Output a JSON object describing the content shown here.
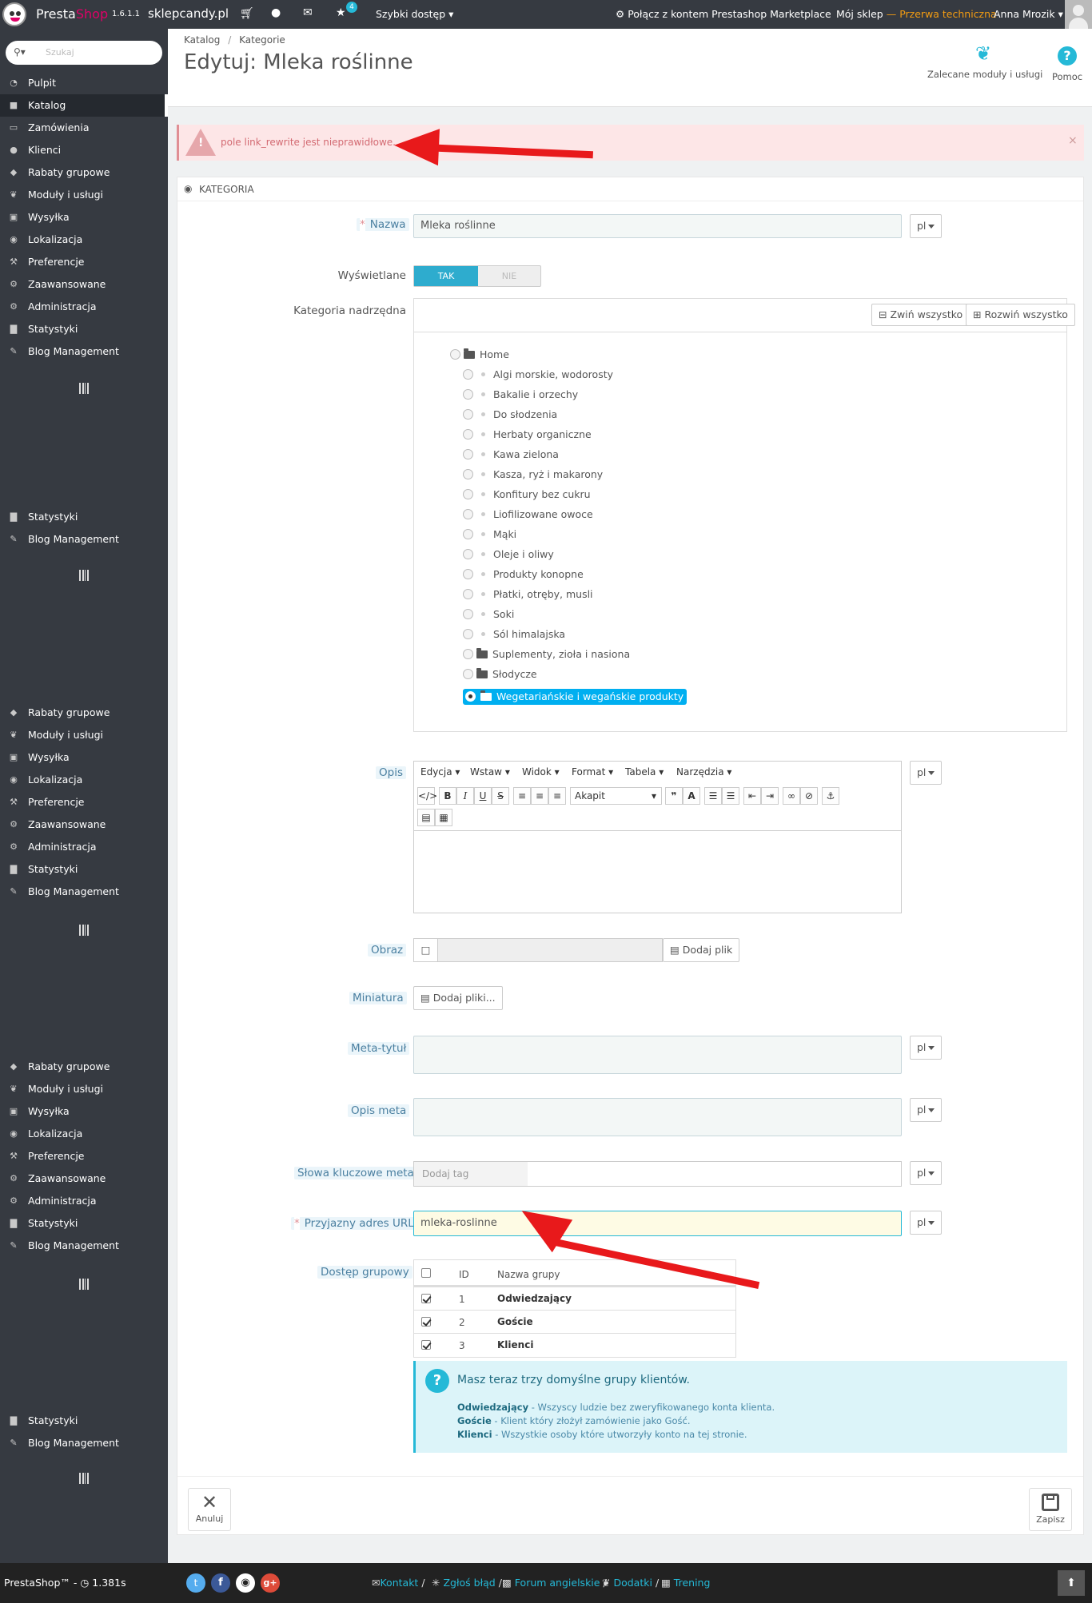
{
  "topbar": {
    "brand_presta": "Presta",
    "brand_shop": "Shop",
    "version": "1.6.1.1",
    "shop_name": "sklepcandy.pl",
    "notification_count": "4",
    "quick_access": "Szybki dostęp",
    "marketplace": "Połącz z kontem Prestashop Marketplace",
    "my_shop": "Mój sklep",
    "dash": "—",
    "maintenance": "Przerwa techniczna",
    "user": "Anna Mrozik"
  },
  "search": {
    "placeholder": "Szukaj"
  },
  "sidebar": {
    "items": [
      {
        "label": "Pulpit",
        "icon": "dashboard-icon"
      },
      {
        "label": "Katalog",
        "icon": "book-icon"
      },
      {
        "label": "Zamówienia",
        "icon": "credit-card-icon"
      },
      {
        "label": "Klienci",
        "icon": "users-icon"
      },
      {
        "label": "Rabaty grupowe",
        "icon": "tags-icon"
      },
      {
        "label": "Moduły i usługi",
        "icon": "puzzle-icon"
      },
      {
        "label": "Wysyłka",
        "icon": "truck-icon"
      },
      {
        "label": "Lokalizacja",
        "icon": "globe-icon"
      },
      {
        "label": "Preferencje",
        "icon": "wrench-icon"
      },
      {
        "label": "Zaawansowane",
        "icon": "cogs-icon"
      },
      {
        "label": "Administracja",
        "icon": "cog-icon"
      },
      {
        "label": "Statystyki",
        "icon": "bar-chart-icon"
      },
      {
        "label": "Blog Management",
        "icon": "pencil-icon"
      }
    ]
  },
  "breadcrumb": {
    "item1": "Katalog",
    "sep": "/",
    "item2": "Kategorie"
  },
  "page_title": "Edytuj: Mleka roślinne",
  "toolbar": {
    "recommended": "Zalecane moduły i usługi",
    "help": "Pomoc"
  },
  "alert": {
    "message": "pole link_rewrite jest nieprawidłowe.",
    "close": "×"
  },
  "panel": {
    "heading": "KATEGORIA"
  },
  "form": {
    "name_label": "Nazwa",
    "name_value": "Mleka roślinne",
    "lang": "pl",
    "required_mark": "*",
    "displayed_label": "Wyświetlane",
    "yes": "TAK",
    "no": "NIE",
    "parent_label": "Kategoria nadrzędna",
    "collapse_all": "Zwiń wszystko",
    "expand_all": "Rozwiń wszystko",
    "tree_root": "Home",
    "tree_items": [
      {
        "label": "Algi morskie, wodorosty",
        "type": "leaf"
      },
      {
        "label": "Bakalie i orzechy",
        "type": "leaf"
      },
      {
        "label": "Do słodzenia",
        "type": "leaf"
      },
      {
        "label": "Herbaty organiczne",
        "type": "leaf"
      },
      {
        "label": "Kawa zielona",
        "type": "leaf"
      },
      {
        "label": "Kasza, ryż i makarony",
        "type": "leaf"
      },
      {
        "label": "Konfitury bez cukru",
        "type": "leaf"
      },
      {
        "label": "Liofilizowane owoce",
        "type": "leaf"
      },
      {
        "label": "Mąki",
        "type": "leaf"
      },
      {
        "label": "Oleje i oliwy",
        "type": "leaf"
      },
      {
        "label": "Produkty konopne",
        "type": "leaf"
      },
      {
        "label": "Płatki, otręby, musli",
        "type": "leaf"
      },
      {
        "label": "Soki",
        "type": "leaf"
      },
      {
        "label": "Sól himalajska",
        "type": "leaf"
      },
      {
        "label": "Suplementy, zioła i nasiona",
        "type": "folder"
      },
      {
        "label": "Słodycze",
        "type": "folder"
      }
    ],
    "tree_selected": "Wegetariańskie i wegańskie produkty",
    "desc_label": "Opis",
    "editor_menus": [
      "Edycja",
      "Wstaw",
      "Widok",
      "Format",
      "Tabela",
      "Narzędzia"
    ],
    "editor_format": "Akapit",
    "image_label": "Obraz",
    "add_file": "Dodaj plik",
    "thumb_label": "Miniatura",
    "add_files": "Dodaj pliki...",
    "meta_title_label": "Meta-tytuł",
    "meta_desc_label": "Opis meta",
    "meta_kw_label": "Słowa kluczowe meta",
    "add_tag": "Dodaj tag",
    "friendly_url_label": "Przyjazny adres URL",
    "friendly_url_value": "mleka-roslinne",
    "group_access_label": "Dostęp grupowy",
    "groups_head": {
      "id": "ID",
      "name": "Nazwa grupy"
    },
    "groups": [
      {
        "id": "1",
        "name": "Odwiedzający"
      },
      {
        "id": "2",
        "name": "Goście"
      },
      {
        "id": "3",
        "name": "Klienci"
      }
    ],
    "info_title": "Masz teraz trzy domyślne grupy klientów.",
    "info_lines": [
      {
        "bold": "Odwiedzający",
        "text": " - Wszyscy ludzie bez zweryfikowanego konta klienta."
      },
      {
        "bold": "Goście",
        "text": " - Klient który złożył zamówienie jako Gość."
      },
      {
        "bold": "Klienci",
        "text": " - Wszystkie osoby które utworzyły konto na tej stronie."
      }
    ],
    "cancel": "Anuluj",
    "save": "Zapisz"
  },
  "footer": {
    "brand": "PrestaShop™",
    "sep1": "-",
    "time": "1.381s",
    "contact": "Kontakt",
    "report": "Zgłoś błąd",
    "forum": "Forum angielskie",
    "addons": "Dodatki",
    "training": "Trening",
    "slash": "/"
  },
  "colors": {
    "sidebar": "#363a41",
    "accent": "#25b9d7",
    "alert_bg": "#fde6e7",
    "info_bg": "#dcf4f9",
    "arrow": "#e8191b"
  }
}
